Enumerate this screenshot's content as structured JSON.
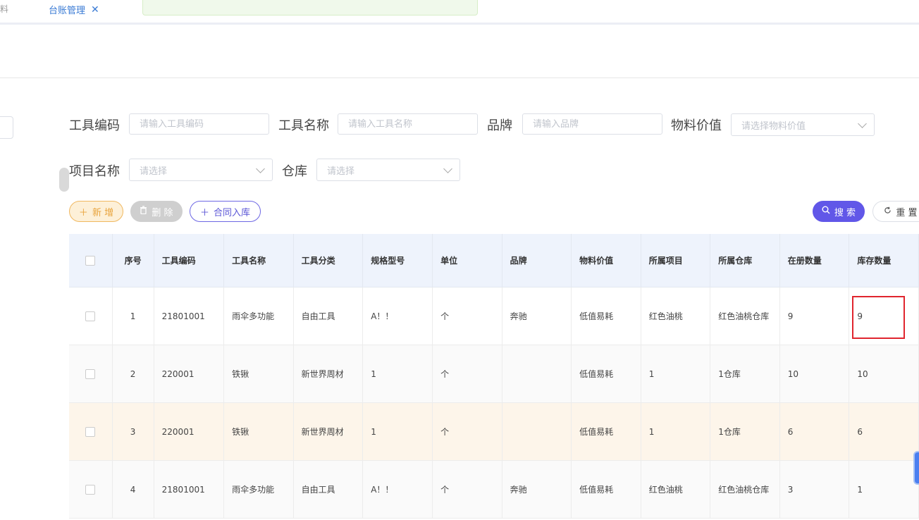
{
  "tabs": {
    "partial_label": "料",
    "active_label": "台账管理",
    "close_icon": "close-icon"
  },
  "filters": {
    "tool_code": {
      "label": "工具编码",
      "placeholder": "请输入工具编码",
      "value": ""
    },
    "tool_name": {
      "label": "工具名称",
      "placeholder": "请输入工具名称",
      "value": ""
    },
    "brand": {
      "label": "品牌",
      "placeholder": "请输入品牌",
      "value": ""
    },
    "material_value": {
      "label": "物料价值",
      "placeholder": "请选择物料价值"
    },
    "project_name": {
      "label": "项目名称",
      "placeholder": "请选择"
    },
    "warehouse": {
      "label": "仓库",
      "placeholder": "请选择"
    }
  },
  "actions": {
    "add": "新 增",
    "delete": "删 除",
    "contract_inbound": "合同入库",
    "search": "搜 索",
    "reset": "重 置"
  },
  "table": {
    "headers": [
      "序号",
      "工具编码",
      "工具名称",
      "工具分类",
      "规格型号",
      "单位",
      "品牌",
      "物料价值",
      "所属项目",
      "所属仓库",
      "在册数量",
      "库存数量"
    ],
    "rows": [
      [
        "1",
        "21801001",
        "雨伞多功能",
        "自由工具",
        "A！！",
        "个",
        "奔驰",
        "低值易耗",
        "红色油桃",
        "红色油桃仓库",
        "9",
        "9"
      ],
      [
        "2",
        "220001",
        "铁锹",
        "新世界周材",
        "1",
        "个",
        "",
        "低值易耗",
        "1",
        "1仓库",
        "10",
        "10"
      ],
      [
        "3",
        "220001",
        "铁锹",
        "新世界周材",
        "1",
        "个",
        "",
        "低值易耗",
        "1",
        "1仓库",
        "6",
        "6"
      ],
      [
        "4",
        "21801001",
        "雨伞多功能",
        "自由工具",
        "A！！",
        "个",
        "奔驰",
        "低值易耗",
        "红色油桃",
        "红色油桃仓库",
        "3",
        "1"
      ]
    ]
  },
  "colors": {
    "primary": "#6157e8",
    "add_accent": "#e8a33b",
    "highlight_box": "#e0252e",
    "header_bg": "#eef3fc"
  }
}
